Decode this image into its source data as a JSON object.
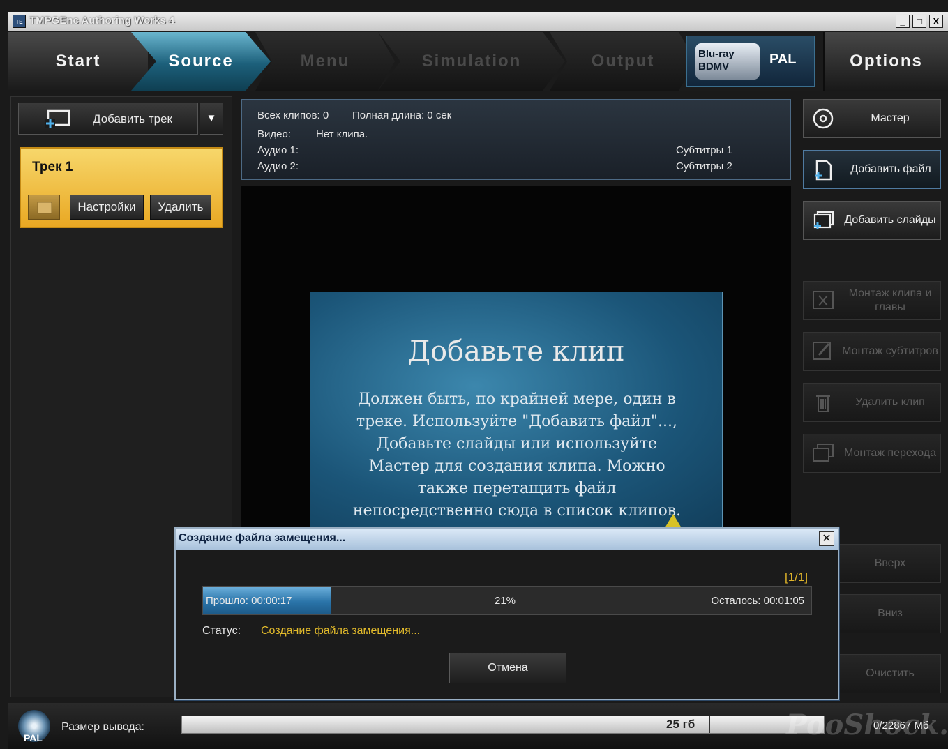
{
  "window": {
    "title": "TMPGEnc Authoring Works 4",
    "app_icon_text": "TE",
    "controls": {
      "minimize": "_",
      "maximize": "□",
      "close": "X"
    }
  },
  "nav": {
    "steps": [
      "Start",
      "Source",
      "Menu",
      "Simulation",
      "Output"
    ],
    "active_step": "Source",
    "format_logo": "Blu-ray BDMV",
    "format_standard": "PAL",
    "options_label": "Options"
  },
  "left_panel": {
    "add_track_label": "Добавить трек",
    "dropdown_glyph": "▼",
    "track": {
      "title": "Трек 1",
      "settings_label": "Настройки",
      "delete_label": "Удалить"
    }
  },
  "info": {
    "total_clips": "Всех клипов: 0",
    "total_length": "Полная длина: 0 сек",
    "video_label": "Видео:",
    "video_value": "Нет клипа.",
    "audio1_label": "Аудио 1:",
    "audio2_label": "Аудио 2:",
    "subtitles1_label": "Субтитры 1",
    "subtitles2_label": "Субтитры 2"
  },
  "preview": {
    "title": "Добавьте клип",
    "body": "Должен быть, по крайней мере, один в треке. Используйте \"Добавить файл\"..., Добавьте слайды или используйте Мастер для создания клипа. Можно также перетащить файл непосредственно сюда в список клипов."
  },
  "right_panel": {
    "wizard": "Мастер",
    "add_file": "Добавить файл",
    "add_slides": "Добавить слайды",
    "edit_clip_chapter": "Монтаж клипа и главы",
    "edit_subtitles": "Монтаж субтитров",
    "delete_clip": "Удалить клип",
    "edit_transition": "Монтаж перехода",
    "up": "Вверх",
    "down": "Вниз",
    "clear": "Очистить"
  },
  "dialog": {
    "title": "Создание файла замещения...",
    "close_glyph": "✕",
    "counter": "[1/1]",
    "elapsed": "Прошло: 00:00:17",
    "percent": "21%",
    "progress_value": 21,
    "remaining": "Осталось: 00:01:05",
    "status_label": "Статус:",
    "status_value": "Создание файла замещения...",
    "cancel_label": "Отмена"
  },
  "bottom": {
    "disc_label": "PAL",
    "output_label": "Размер вывода:",
    "capacity": "25 гб",
    "usage": "0/22867 Мб",
    "watermark": "PooShock.Ru"
  },
  "colors": {
    "accent_blue": "#2a74a9",
    "track_yellow": "#e9a823",
    "status_yellow": "#e3bb2b",
    "background": "#1a1a1a"
  }
}
